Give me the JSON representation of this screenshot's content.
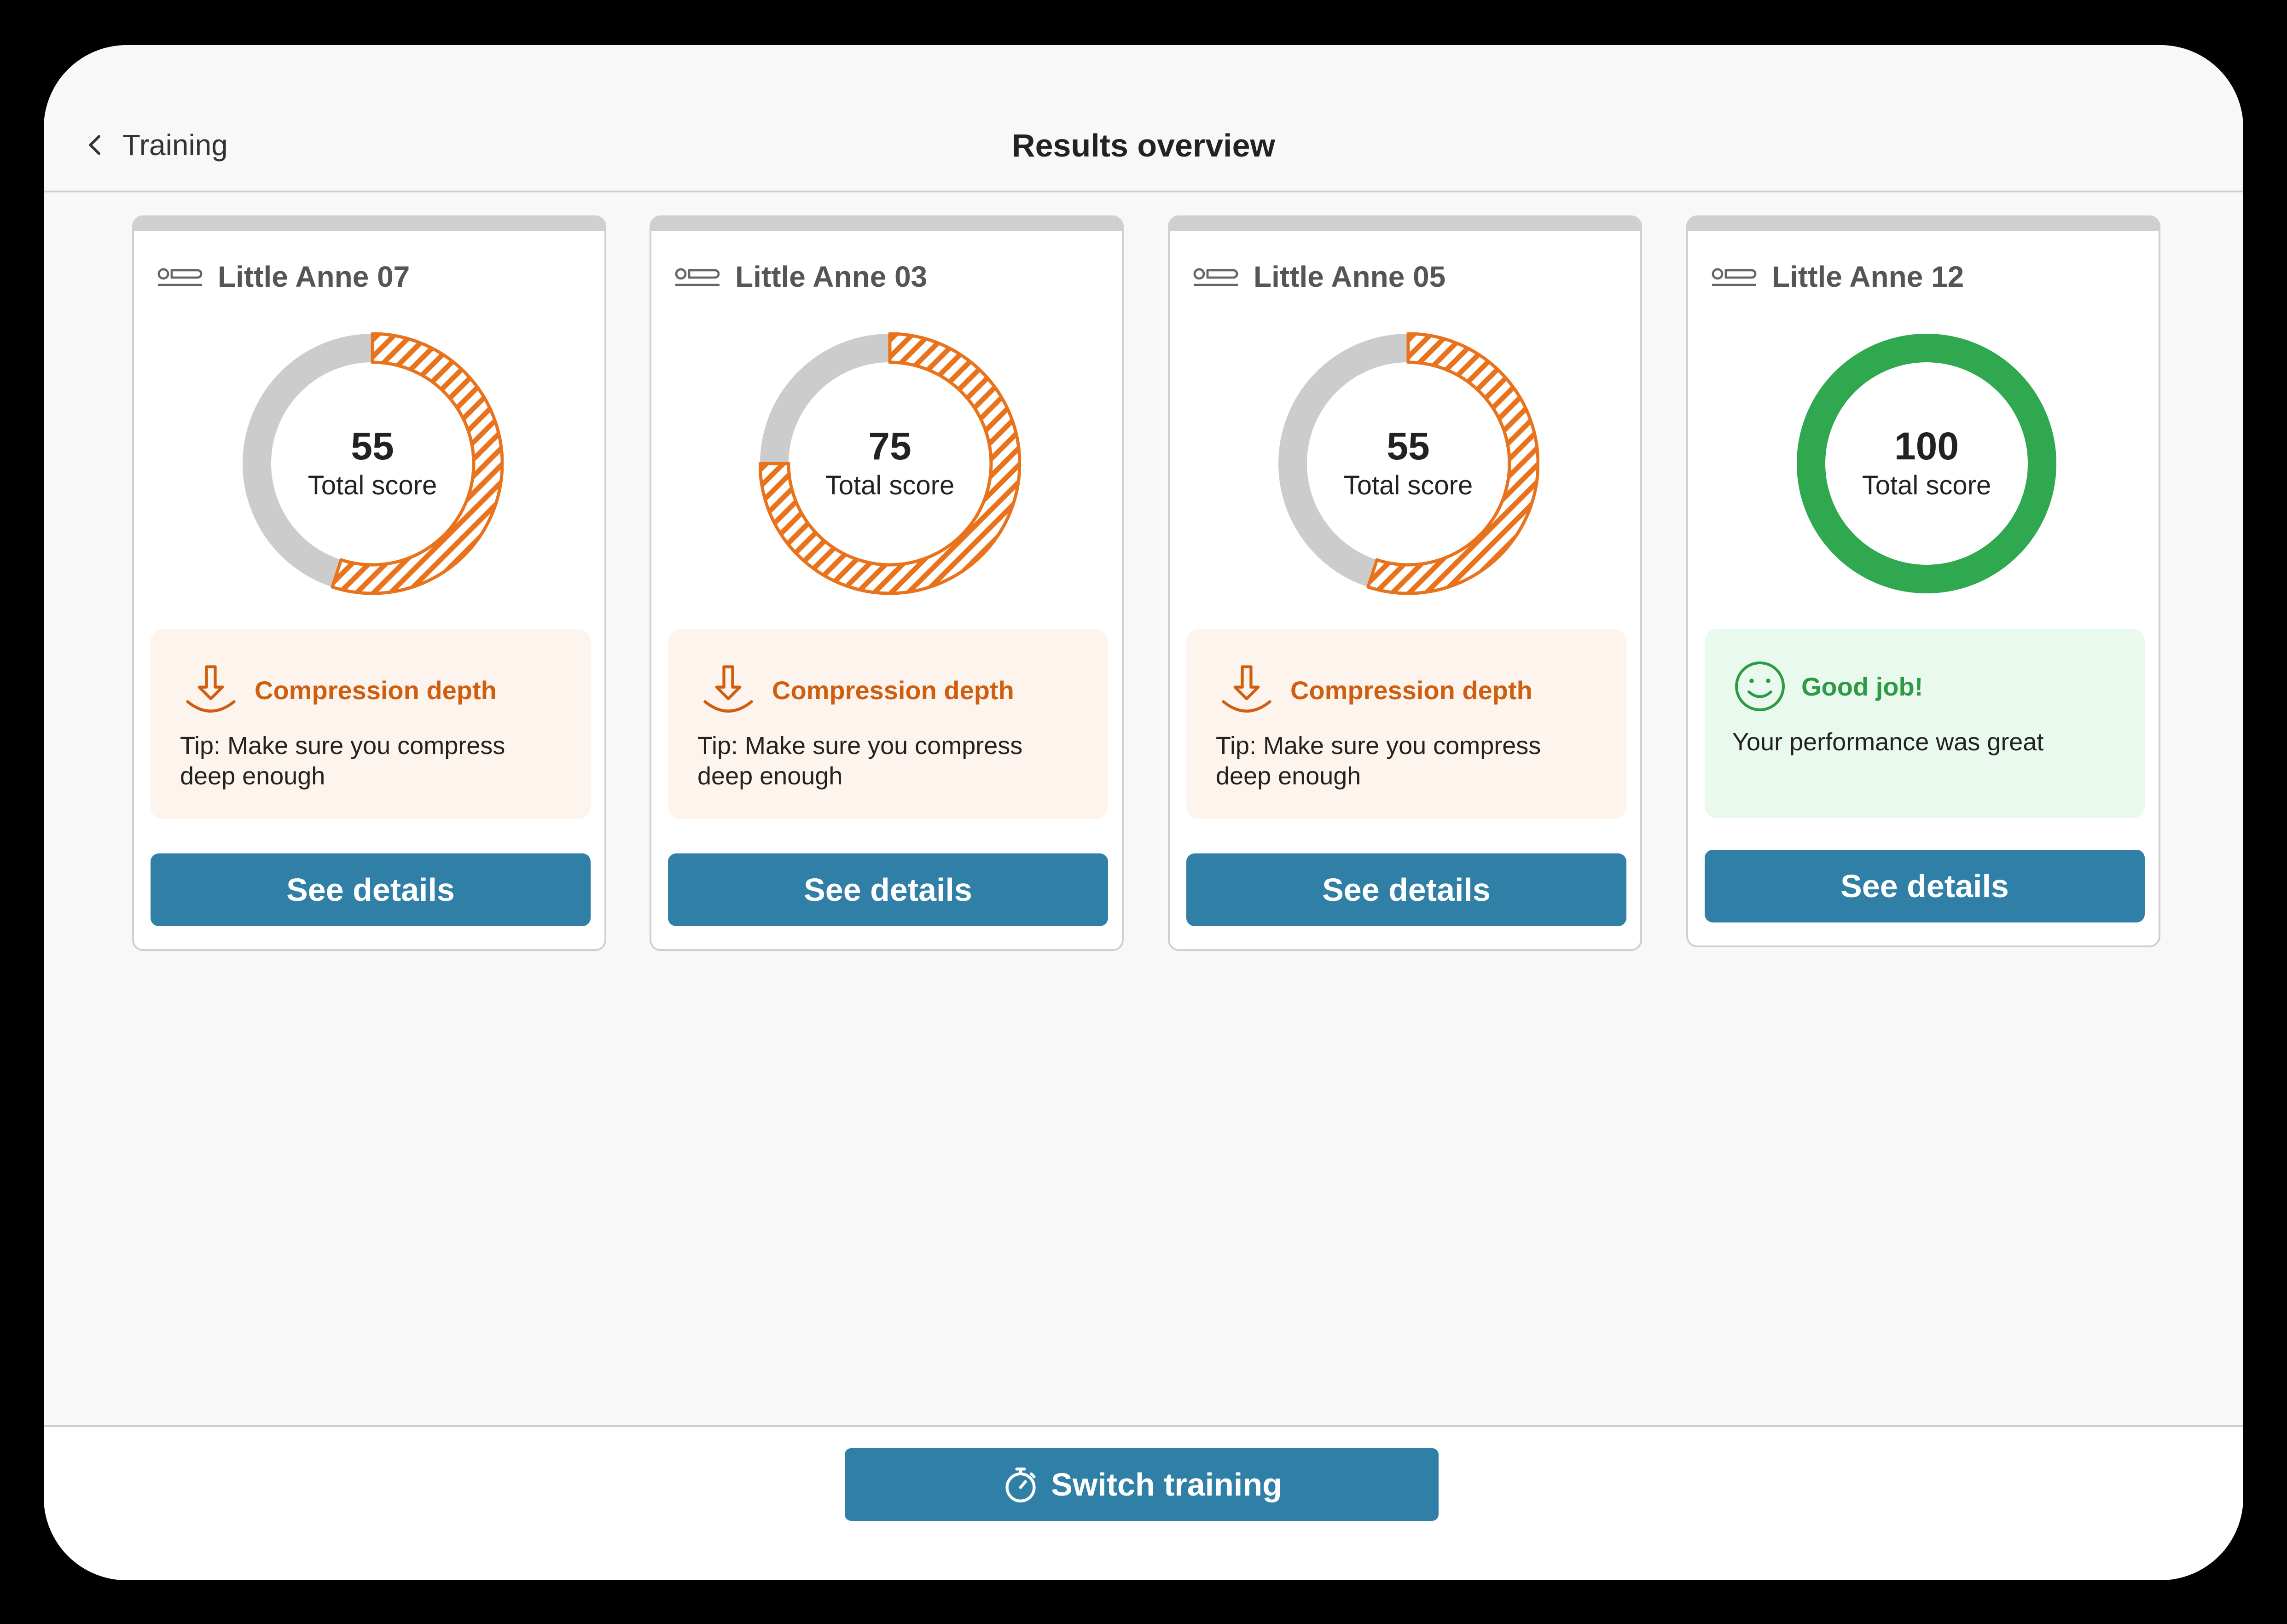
{
  "header": {
    "back_label": "Training",
    "title": "Results overview"
  },
  "colors": {
    "accent_button": "#2f7fa6",
    "warning": "#e8731c",
    "success": "#2fa84f",
    "track": "#cccccc"
  },
  "cards": [
    {
      "name": "Little Anne 07",
      "score": "55",
      "score_value": 55,
      "score_label": "Total score",
      "status": "warning",
      "tip_title": "Compression depth",
      "tip_body": "Tip: Make sure you compress deep enough",
      "tip_icon": "arrow-down-icon",
      "button_label": "See details"
    },
    {
      "name": "Little Anne 03",
      "score": "75",
      "score_value": 75,
      "score_label": "Total score",
      "status": "warning",
      "tip_title": "Compression depth",
      "tip_body": "Tip: Make sure you compress deep enough",
      "tip_icon": "arrow-down-icon",
      "button_label": "See details"
    },
    {
      "name": "Little Anne 05",
      "score": "55",
      "score_value": 55,
      "score_label": "Total score",
      "status": "warning",
      "tip_title": "Compression depth",
      "tip_body": "Tip: Make sure you compress deep enough",
      "tip_icon": "arrow-down-icon",
      "button_label": "See details"
    },
    {
      "name": "Little Anne 12",
      "score": "100",
      "score_value": 100,
      "score_label": "Total score",
      "status": "good",
      "tip_title": "Good job!",
      "tip_body": "Your performance was great",
      "tip_icon": "smiley-icon",
      "button_label": "See details"
    }
  ],
  "footer": {
    "switch_label": "Switch training",
    "switch_icon": "stopwatch-icon"
  }
}
